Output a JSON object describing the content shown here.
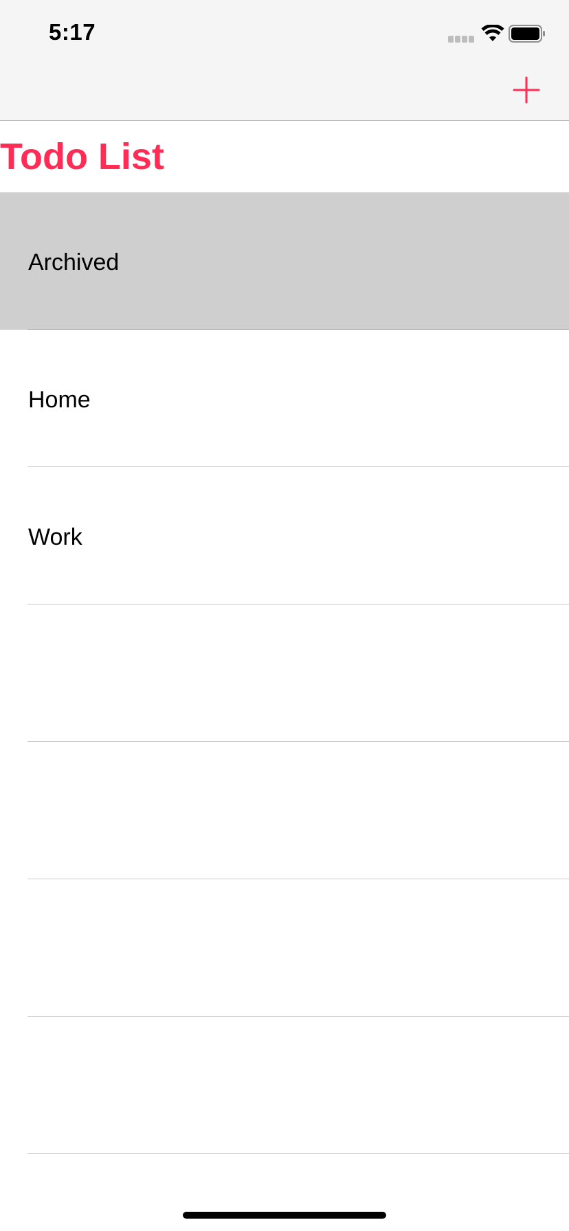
{
  "status_bar": {
    "time": "5:17"
  },
  "nav_bar": {
    "add_icon": "plus-icon"
  },
  "page": {
    "title": "Todo List"
  },
  "list": {
    "items": [
      {
        "label": "Archived",
        "selected": true
      },
      {
        "label": "Home",
        "selected": false
      },
      {
        "label": "Work",
        "selected": false
      },
      {
        "label": "",
        "selected": false
      },
      {
        "label": "",
        "selected": false
      },
      {
        "label": "",
        "selected": false
      },
      {
        "label": "",
        "selected": false
      }
    ]
  },
  "colors": {
    "accent": "#ff2d55",
    "selected_row": "#cfcfcf",
    "nav_background": "#f6f5f6"
  }
}
